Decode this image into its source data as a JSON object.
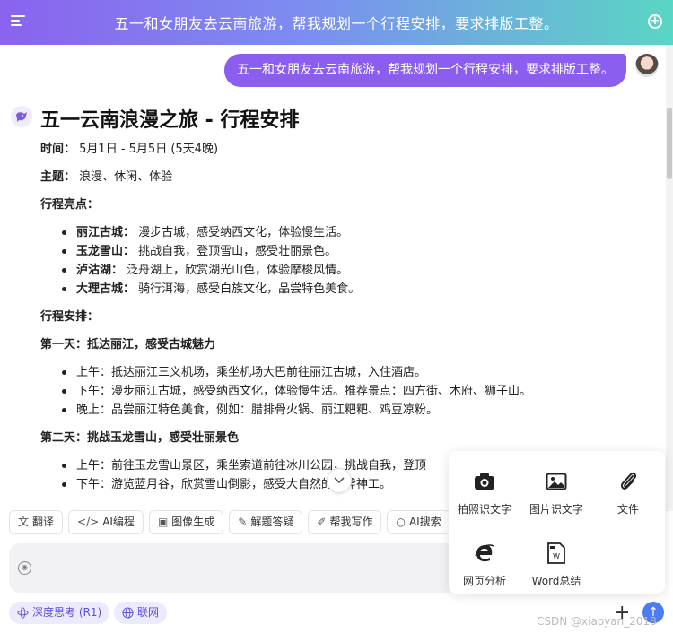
{
  "header": {
    "title": "五一和女朋友去云南旅游，帮我规划一个行程安排，要求排版工整。"
  },
  "user_message": "五一和女朋友去云南旅游，帮我规划一个行程安排，要求排版工整。",
  "answer": {
    "title": "五一云南浪漫之旅 - 行程安排",
    "time_label": "时间：",
    "time_value": "5月1日 - 5月5日 (5天4晚)",
    "theme_label": "主题：",
    "theme_value": "浪漫、休闲、体验",
    "highlights_label": "行程亮点：",
    "highlights": [
      {
        "name": "丽江古城：",
        "desc": "漫步古城，感受纳西文化，体验慢生活。"
      },
      {
        "name": "玉龙雪山：",
        "desc": "挑战自我，登顶雪山，感受壮丽景色。"
      },
      {
        "name": "泸沽湖：",
        "desc": "泛舟湖上，欣赏湖光山色，体验摩梭风情。"
      },
      {
        "name": "大理古城：",
        "desc": "骑行洱海，感受白族文化，品尝特色美食。"
      }
    ],
    "schedule_label": "行程安排：",
    "day1_title": "第一天：抵达丽江，感受古城魅力",
    "day1": [
      "上午：抵达丽江三义机场，乘坐机场大巴前往丽江古城，入住酒店。",
      "下午：漫步丽江古城，感受纳西文化，体验慢生活。推荐景点：四方街、木府、狮子山。",
      "晚上：品尝丽江特色美食，例如：腊排骨火锅、丽江粑粑、鸡豆凉粉。"
    ],
    "day2_title": "第二天：挑战玉龙雪山，感受壮丽景色",
    "day2": [
      "上午：前往玉龙雪山景区，乘坐索道前往冰川公园，挑战自我，登顶",
      "下午：游览蓝月谷，欣赏雪山倒影，感受大自然的鬼斧神工。"
    ]
  },
  "toolbar": [
    {
      "icon": "文",
      "label": "翻译"
    },
    {
      "icon": "</>",
      "label": "AI编程"
    },
    {
      "icon": "▣",
      "label": "图像生成"
    },
    {
      "icon": "✎",
      "label": "解题答疑"
    },
    {
      "icon": "✐",
      "label": "帮我写作"
    },
    {
      "icon": "○",
      "label": "AI搜索"
    }
  ],
  "input": {
    "placeholder": ""
  },
  "modes": {
    "deep_think": "深度思考 (R1)",
    "web": "联网"
  },
  "popup": {
    "photo_ocr": "拍照识文字",
    "image_ocr": "图片识文字",
    "file": "文件",
    "web_analysis": "网页分析",
    "word_summary": "Word总结"
  },
  "watermark": "CSDN @xiaoyan_2018",
  "colors": {
    "accent": "#8c5ef0",
    "send": "#4c7bf2",
    "chip_bg": "#ecebfd"
  }
}
